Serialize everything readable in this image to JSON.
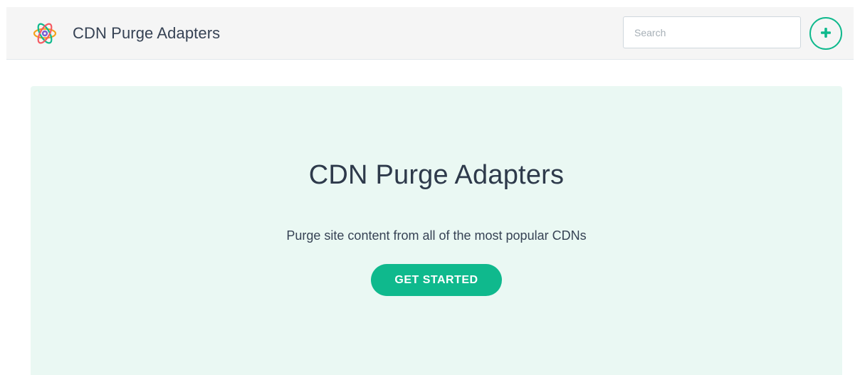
{
  "header": {
    "logo_icon": "atom-logo-icon",
    "app_title": "CDN Purge Adapters",
    "search": {
      "value": "",
      "placeholder": "Search"
    },
    "add_button": {
      "icon": "plus-circle-icon",
      "color": "#0fb98d"
    }
  },
  "hero": {
    "title": "CDN Purge Adapters",
    "subtitle": "Purge site content from all of the most popular CDNs",
    "cta_label": "GET STARTED",
    "background_color": "#eaf8f3",
    "accent_color": "#0fb98d"
  }
}
